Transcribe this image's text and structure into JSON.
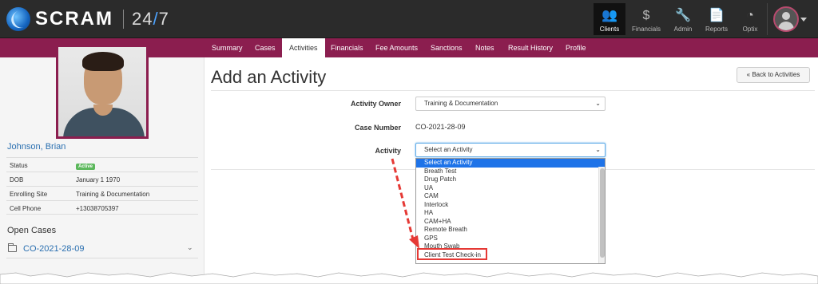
{
  "header": {
    "logo_text": "SCRAM",
    "logo_hours_a": "24",
    "logo_hours_slash": "/",
    "logo_hours_b": "7",
    "nav": [
      {
        "label": "Clients",
        "icon": "users-icon",
        "glyph": "👥"
      },
      {
        "label": "Financials",
        "icon": "dollar-icon",
        "glyph": "$"
      },
      {
        "label": "Admin",
        "icon": "wrench-icon",
        "glyph": "🔧"
      },
      {
        "label": "Reports",
        "icon": "document-icon",
        "glyph": "📄"
      },
      {
        "label": "Optix",
        "icon": "dashboard-icon",
        "glyph": "◔"
      }
    ],
    "active_nav": "Clients"
  },
  "tabs": [
    "Summary",
    "Cases",
    "Activities",
    "Financials",
    "Fee Amounts",
    "Sanctions",
    "Notes",
    "Result History",
    "Profile"
  ],
  "active_tab": "Activities",
  "client": {
    "name": "Johnson, Brian",
    "details": [
      {
        "label": "Status",
        "value": "Active",
        "badge": true
      },
      {
        "label": "DOB",
        "value": "January 1 1970"
      },
      {
        "label": "Enrolling Site",
        "value": "Training & Documentation"
      },
      {
        "label": "Cell Phone",
        "value": "+13038705397"
      }
    ],
    "open_cases_heading": "Open Cases",
    "open_cases": [
      "CO-2021-28-09"
    ]
  },
  "main": {
    "title": "Add an Activity",
    "back_button": "« Back to Activities",
    "fields": {
      "owner_label": "Activity Owner",
      "owner_value": "Training & Documentation",
      "case_label": "Case Number",
      "case_value": "CO-2021-28-09",
      "activity_label": "Activity",
      "activity_value": "Select an Activity"
    },
    "activity_options": [
      "Select an Activity",
      "Breath Test",
      "Drug Patch",
      "UA",
      "CAM",
      "Interlock",
      "HA",
      "CAM+HA",
      "Remote Breath",
      "GPS",
      "Mouth Swab",
      "Client Test Check-in"
    ],
    "highlighted_option": "Client Test Check-in"
  },
  "colors": {
    "topbar": "#2b2b2b",
    "tabbar": "#8b1e4f",
    "link": "#2a6fb0",
    "selected_option": "#1e73e8",
    "annotation": "#e53935"
  }
}
